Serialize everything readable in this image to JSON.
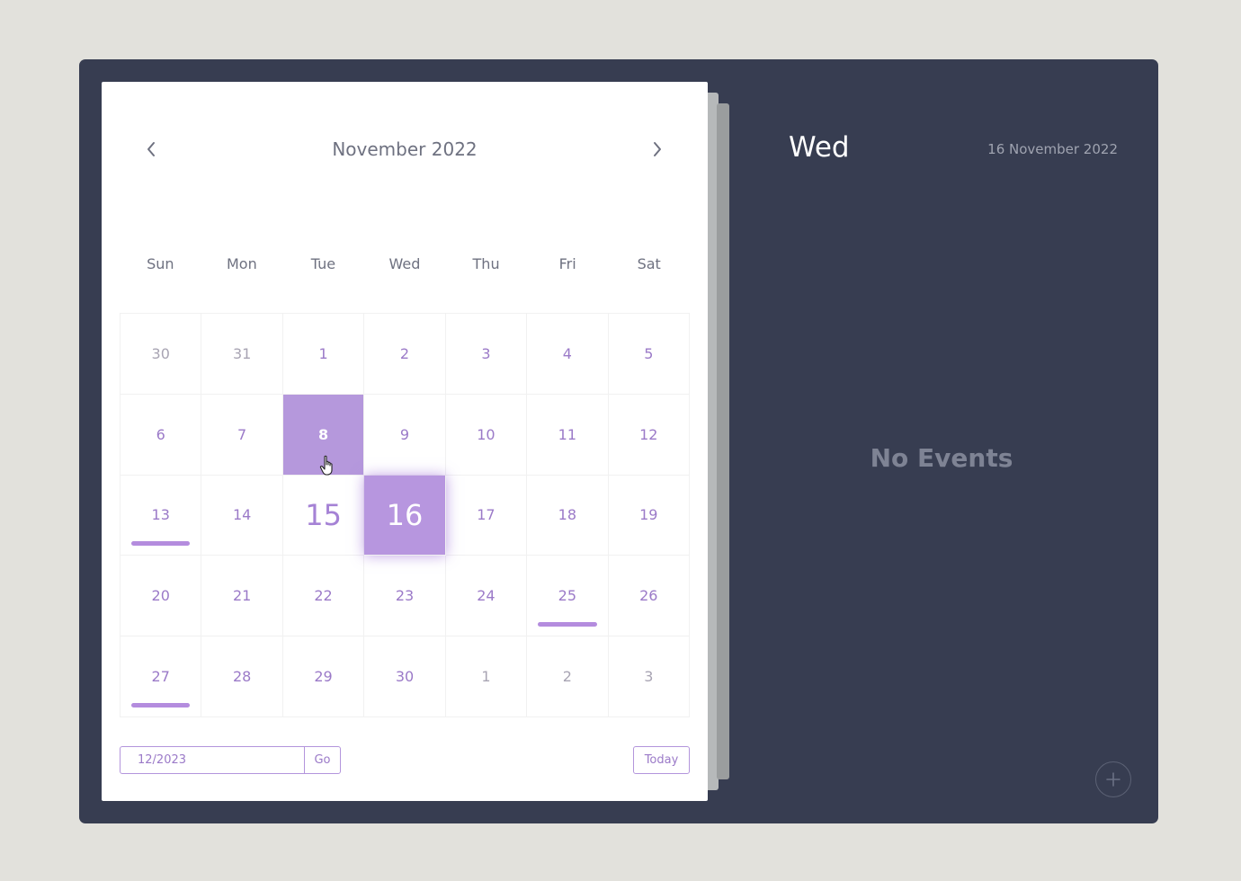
{
  "calendar": {
    "month_title": "November 2022",
    "prev_icon": "chevron-left-icon",
    "next_icon": "chevron-right-icon",
    "weekdays": [
      "Sun",
      "Mon",
      "Tue",
      "Wed",
      "Thu",
      "Fri",
      "Sat"
    ],
    "weeks": [
      [
        "30",
        "31",
        "1",
        "2",
        "3",
        "4",
        "5"
      ],
      [
        "6",
        "7",
        "8",
        "9",
        "10",
        "11",
        "12"
      ],
      [
        "13",
        "14",
        "15",
        "16",
        "17",
        "18",
        "19"
      ],
      [
        "20",
        "21",
        "22",
        "23",
        "24",
        "25",
        "26"
      ],
      [
        "27",
        "28",
        "29",
        "30",
        "1",
        "2",
        "3"
      ]
    ],
    "today_day": "15",
    "selected_day": "16",
    "hovered_day": "8",
    "days_with_events": [
      "13",
      "25",
      "27"
    ],
    "date_input_value": "12/2023",
    "go_label": "Go",
    "today_label": "Today"
  },
  "events_panel": {
    "day_name": "Wed",
    "full_date": "16 November 2022",
    "empty_text": "No Events",
    "add_icon": "plus-circle-icon"
  },
  "colors": {
    "accent": "#b796df",
    "panel_bg": "#373d51",
    "page_bg": "#e2e1dc"
  }
}
